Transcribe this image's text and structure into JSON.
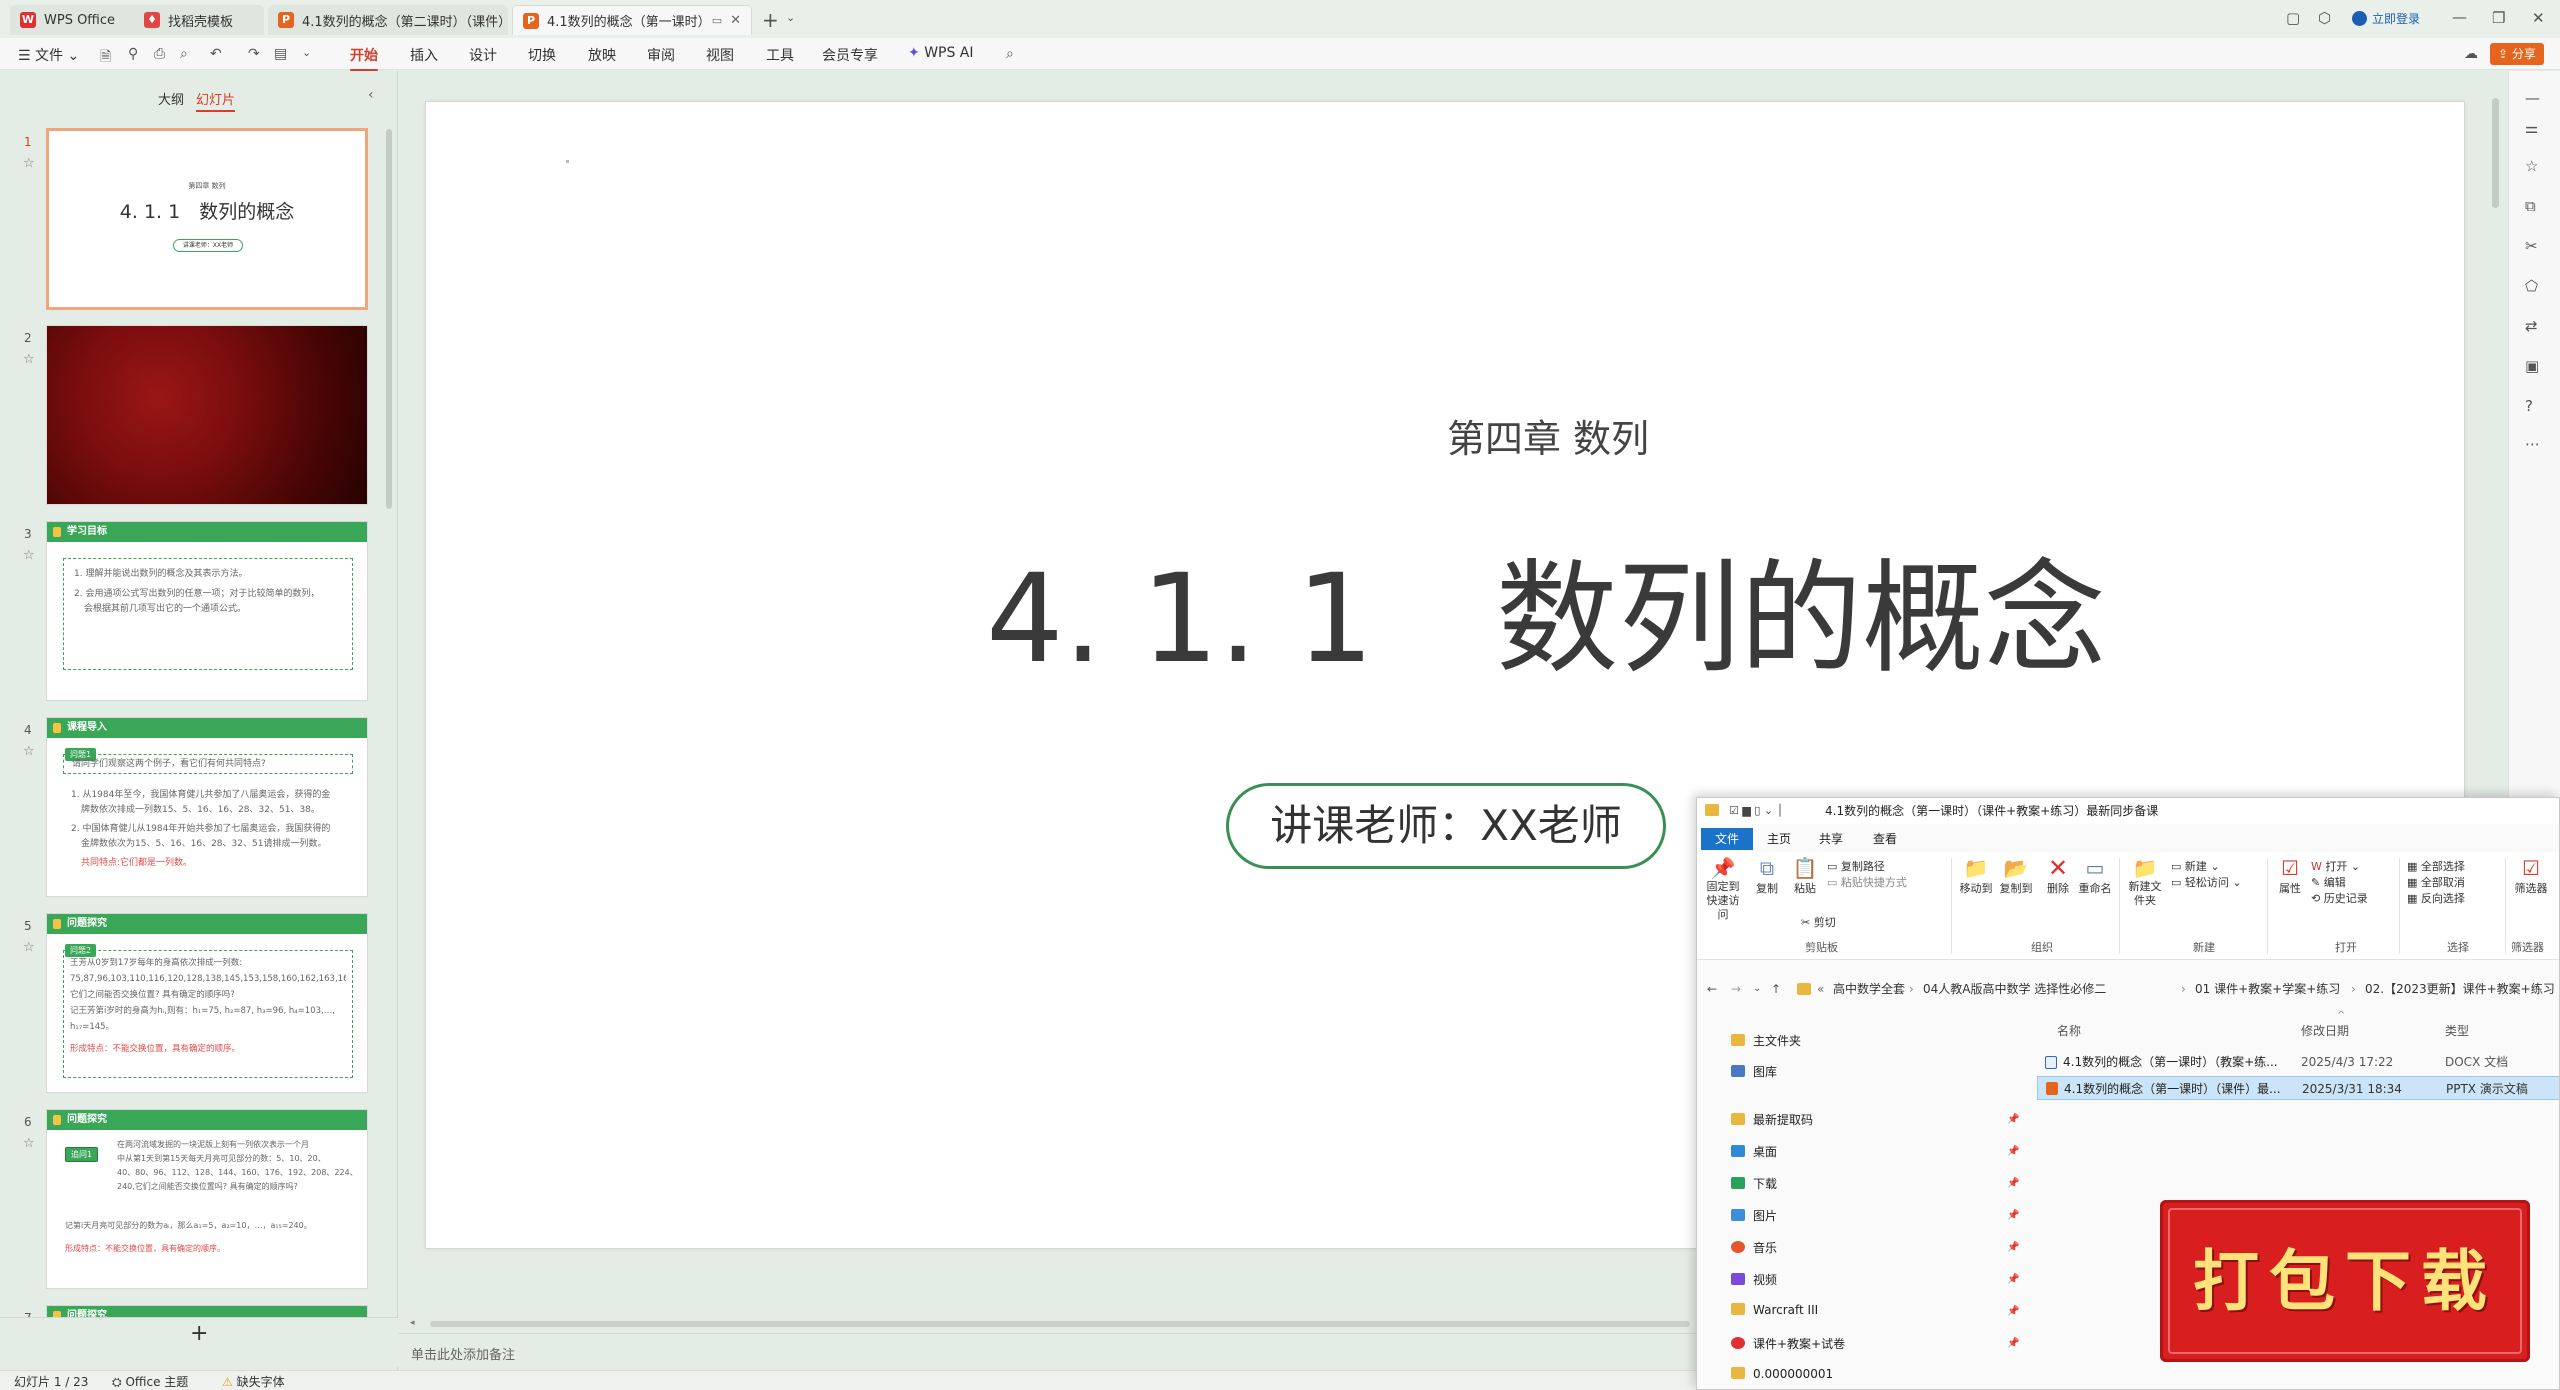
{
  "tabs": [
    {
      "label": "WPS Office"
    },
    {
      "label": "找稻壳模板"
    },
    {
      "label": "4.1数列的概念（第二课时）（课件）"
    },
    {
      "label": "4.1数列的概念（第一课时）"
    }
  ],
  "login_label": "立即登录",
  "share_label": "分享",
  "menu": {
    "file_label": "文件",
    "items": [
      "开始",
      "插入",
      "设计",
      "切换",
      "放映",
      "审阅",
      "视图",
      "工具",
      "会员专享"
    ],
    "ai_label": "WPS AI"
  },
  "panel": {
    "tab_outline": "大纲",
    "tab_slides": "幻灯片",
    "add_label": "+"
  },
  "thumbs": {
    "s1": {
      "num": "1",
      "sub": "第四章 数列",
      "title": "4. 1. 1　数列的概念",
      "badge": "讲课老师：XX老师"
    },
    "s2": {
      "num": "2"
    },
    "s3": {
      "num": "3",
      "head": "学习目标",
      "l1": "1. 理解并能说出数列的概念及其表示方法。",
      "l2": "2. 会用通项公式写出数列的任意一项；对于比较简单的数列，",
      "l3": "会根据其前几项写出它的一个通项公式。"
    },
    "s4": {
      "num": "4",
      "head": "课程导入",
      "badge": "问题1",
      "q": "请同学们观察这两个例子，看它们有何共同特点?",
      "l1": "1. 从1984年至今，我国体育健儿共参加了八届奥运会，获得的金",
      "l2": "牌数依次排成一列数15、5、16、16、28、32、51、38。",
      "l3": "2. 中国体育健儿从1984年开始共参加了七届奥运会，我国获得的",
      "l4": "金牌数依次为15、5、16、16、28、32、51请排成一列数。",
      "l5": "共同特点:它们都是一列数。"
    },
    "s5": {
      "num": "5",
      "head": "问题探究",
      "badge": "问题2",
      "l1": "王芳从0岁到17岁每年的身高依次排成一列数:",
      "l2": "75,87,96,103,110,116,120,128,138,145,153,158,160,162,163,165,168。",
      "l3": "它们之间能否交换位置? 具有确定的顺序吗?",
      "l4": "记王芳第i岁时的身高为hᵢ,则有：h₁=75, h₂=87, h₃=96, h₄=103,…,",
      "l5": "h₁₇=145。",
      "l6": "形成特点：不能交换位置，具有确定的顺序。"
    },
    "s6": {
      "num": "6",
      "head": "问题探究",
      "badge": "追问1",
      "l1": "在两河流域发掘的一块泥版上刻有一列依次表示一个月",
      "l2": "中从第1天到第15天每天月亮可见部分的数：5、10、20、",
      "l3": "40、80、96、112、128、144、160、176、192、208、224、",
      "l4": "240,它们之间能否交换位置吗? 具有确定的顺序吗?",
      "l5": "记第i天月亮可见部分的数为aᵢ，那么a₁=5，a₂=10，…，a₁₅=240。",
      "l6": "形成特点：不能交换位置，具有确定的顺序。"
    },
    "s7": {
      "num": "7",
      "head": "问题探究"
    }
  },
  "slide": {
    "subtitle": "第四章  数列",
    "title": "4. 1. 1　数列的概念",
    "teacher": "讲课老师：XX老师"
  },
  "notes_placeholder": "单击此处添加备注",
  "status": {
    "slide_count": "幻灯片 1 / 23",
    "theme": "Office 主题",
    "missing_font": "缺失字体"
  },
  "explorer": {
    "title": "4.1数列的概念（第一课时）（课件+教案+练习）最新同步备课",
    "ribbon_tabs": [
      "文件",
      "主页",
      "共享",
      "查看"
    ],
    "groups": {
      "clipboard": {
        "pin": "固定到快速访问",
        "copy": "复制",
        "paste": "粘贴",
        "copy_path": "复制路径",
        "paste_shortcut": "粘贴快捷方式",
        "cut": "剪切",
        "label": "剪贴板"
      },
      "organize": {
        "move": "移动到",
        "copyto": "复制到",
        "delete": "删除",
        "rename": "重命名",
        "label": "组织"
      },
      "new": {
        "newfolder": "新建文件夹",
        "newitem": "新建",
        "easy": "轻松访问",
        "label": "新建"
      },
      "open": {
        "props": "属性",
        "open": "打开",
        "edit": "编辑",
        "history": "历史记录",
        "label": "打开"
      },
      "select": {
        "all": "全部选择",
        "none": "全部取消",
        "invert": "反向选择",
        "label": "选择"
      },
      "filter": {
        "btn": "筛选器",
        "label": "筛选器"
      }
    },
    "path": [
      "高中数学全套",
      "04人教A版高中数学 选择性必修二",
      "01 课件+教案+学案+练习",
      "02.【2023更新】课件+教案+练习"
    ],
    "nav": [
      "主文件夹",
      "图库",
      "最新提取码",
      "桌面",
      "下载",
      "图片",
      "音乐",
      "视频",
      "Warcraft III",
      "课件+教案+试卷",
      "0.000000001"
    ],
    "columns": {
      "name": "名称",
      "date": "修改日期",
      "type": "类型"
    },
    "files": [
      {
        "name": "4.1数列的概念（第一课时）（教案+练...",
        "date": "2025/4/3 17:22",
        "type": "DOCX 文档"
      },
      {
        "name": "4.1数列的概念（第一课时）（课件）最...",
        "date": "2025/3/31 18:34",
        "type": "PPTX 演示文稿"
      }
    ]
  },
  "stamp": {
    "text": "打包下载"
  },
  "colors": {
    "accent": "#d93c2a",
    "green": "#3aa657",
    "explorer_blue": "#1a73c9"
  }
}
